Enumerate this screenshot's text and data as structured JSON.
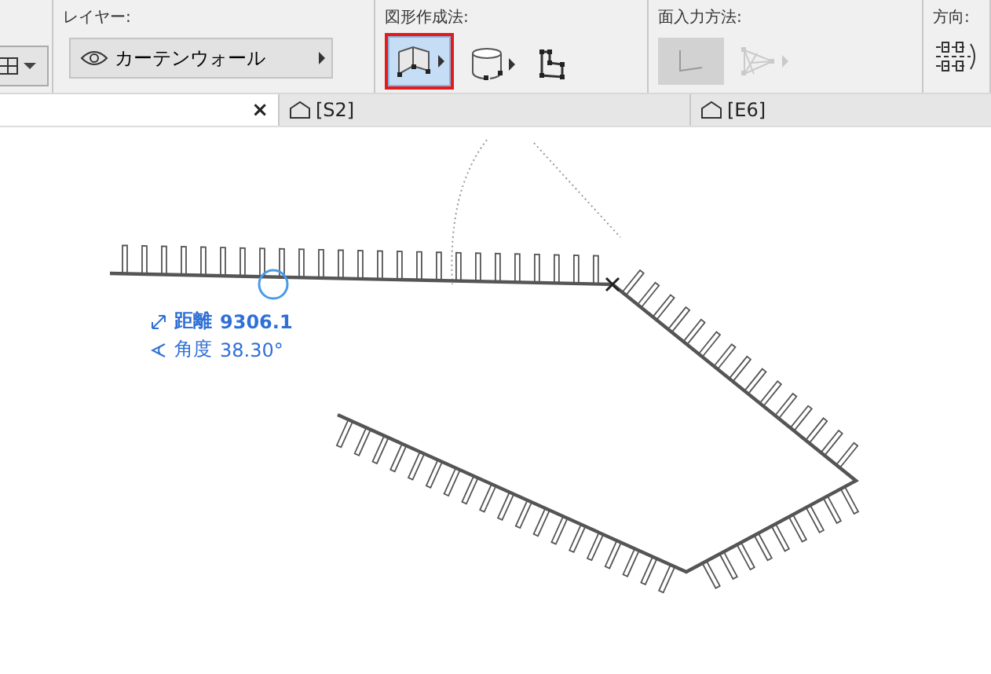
{
  "toolbar": {
    "layer": {
      "label": "レイヤー:",
      "value": "カーテンウォール"
    },
    "geometry_method": {
      "label": "図形作成法:",
      "options": [
        {
          "kind": "chain",
          "selected": true,
          "has_menu": true
        },
        {
          "kind": "curved",
          "selected": false,
          "has_menu": true
        },
        {
          "kind": "polygon",
          "selected": false,
          "has_menu": false
        }
      ]
    },
    "face_input": {
      "label": "面入力方法:",
      "options": [
        {
          "kind": "rectangle",
          "disabled": true,
          "has_menu": false
        },
        {
          "kind": "fan",
          "disabled": true,
          "has_menu": true
        }
      ]
    },
    "direction": {
      "label": "方向:"
    }
  },
  "tabs": [
    {
      "close_glyph": "×",
      "selected": true
    },
    {
      "label": "[S2]",
      "selected": false
    },
    {
      "label": "[E6]",
      "selected": false
    }
  ],
  "measurement": {
    "distance_label": "距離",
    "distance": "9306.1",
    "angle_label": "角度",
    "angle": "38.30°"
  }
}
